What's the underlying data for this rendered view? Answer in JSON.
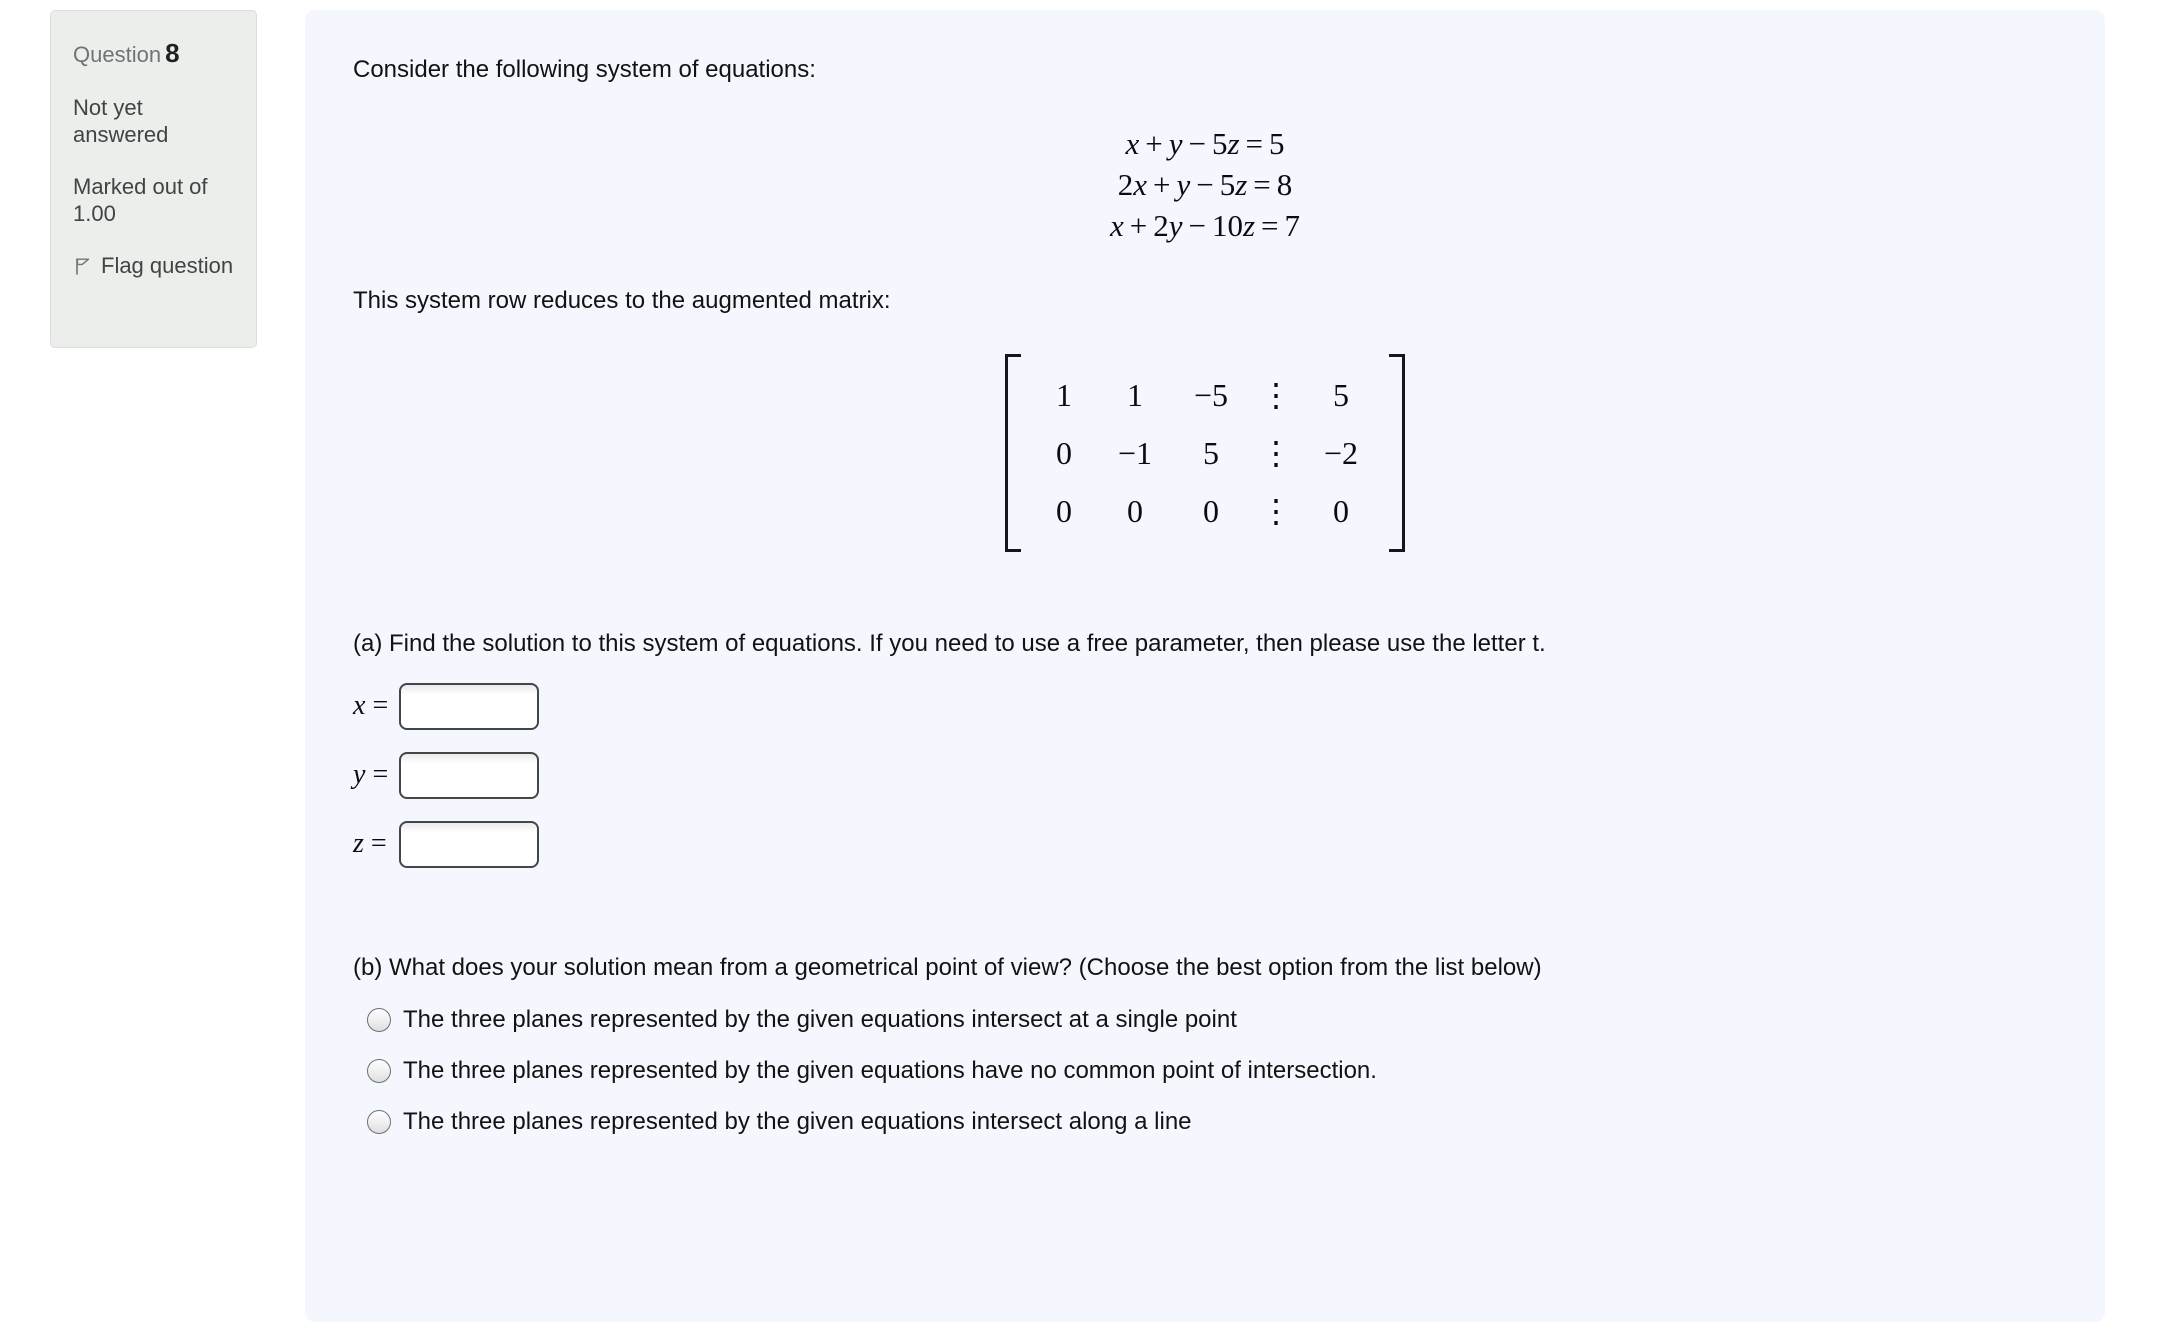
{
  "question_info": {
    "number_label": "Question",
    "number_value": "8",
    "status": "Not yet answered",
    "marks": "Marked out of 1.00",
    "flag_label": "Flag question",
    "flag_icon": "flag-icon"
  },
  "content": {
    "intro_text": "Consider the following system of equations:",
    "equations": [
      {
        "terms": [
          {
            "t": "x",
            "k": "v"
          },
          {
            "t": "+",
            "k": "o"
          },
          {
            "t": "y",
            "k": "v"
          },
          {
            "t": "−",
            "k": "o"
          },
          {
            "t": "5",
            "k": "n"
          },
          {
            "t": "z",
            "k": "v"
          },
          {
            "t": "=",
            "k": "o"
          },
          {
            "t": "5",
            "k": "n"
          }
        ]
      },
      {
        "terms": [
          {
            "t": "2",
            "k": "n"
          },
          {
            "t": "x",
            "k": "v"
          },
          {
            "t": "+",
            "k": "o"
          },
          {
            "t": "y",
            "k": "v"
          },
          {
            "t": "−",
            "k": "o"
          },
          {
            "t": "5",
            "k": "n"
          },
          {
            "t": "z",
            "k": "v"
          },
          {
            "t": "=",
            "k": "o"
          },
          {
            "t": "8",
            "k": "n"
          }
        ]
      },
      {
        "terms": [
          {
            "t": "x",
            "k": "v"
          },
          {
            "t": "+",
            "k": "o"
          },
          {
            "t": "2",
            "k": "n"
          },
          {
            "t": "y",
            "k": "v"
          },
          {
            "t": "−",
            "k": "o"
          },
          {
            "t": "10",
            "k": "n"
          },
          {
            "t": "z",
            "k": "v"
          },
          {
            "t": "=",
            "k": "o"
          },
          {
            "t": "7",
            "k": "n"
          }
        ]
      }
    ],
    "reduces_text": "This system row reduces to the augmented matrix:",
    "matrix": {
      "separator": "⋮",
      "rows": [
        [
          "1",
          "1",
          "−5",
          "⋮",
          "5"
        ],
        [
          "0",
          "−1",
          "5",
          "⋮",
          "−2"
        ],
        [
          "0",
          "0",
          "0",
          "⋮",
          "0"
        ]
      ]
    },
    "part_a": {
      "prompt": "(a) Find the solution to this system of equations. If you need to use a free parameter, then please use the letter t.",
      "fields": [
        {
          "variable": "x",
          "equals": "=",
          "value": "",
          "placeholder": ""
        },
        {
          "variable": "y",
          "equals": "=",
          "value": "",
          "placeholder": ""
        },
        {
          "variable": "z",
          "equals": "=",
          "value": "",
          "placeholder": ""
        }
      ]
    },
    "part_b": {
      "prompt": "(b) What does your solution mean from a geometrical point of view? (Choose the best option from the list below)",
      "options": [
        {
          "label": "The three planes represented by the given equations intersect at a single point",
          "selected": false
        },
        {
          "label": "The three planes represented by the given equations have no common point of intersection.",
          "selected": false
        },
        {
          "label": "The three planes represented by the given equations intersect along a line",
          "selected": false
        }
      ]
    }
  },
  "colors": {
    "panel_background": "#f4f7fd",
    "info_box_background": "#eceeec",
    "page_background": "#ffffff",
    "text": "#121212",
    "muted_text": "#6f7573"
  }
}
